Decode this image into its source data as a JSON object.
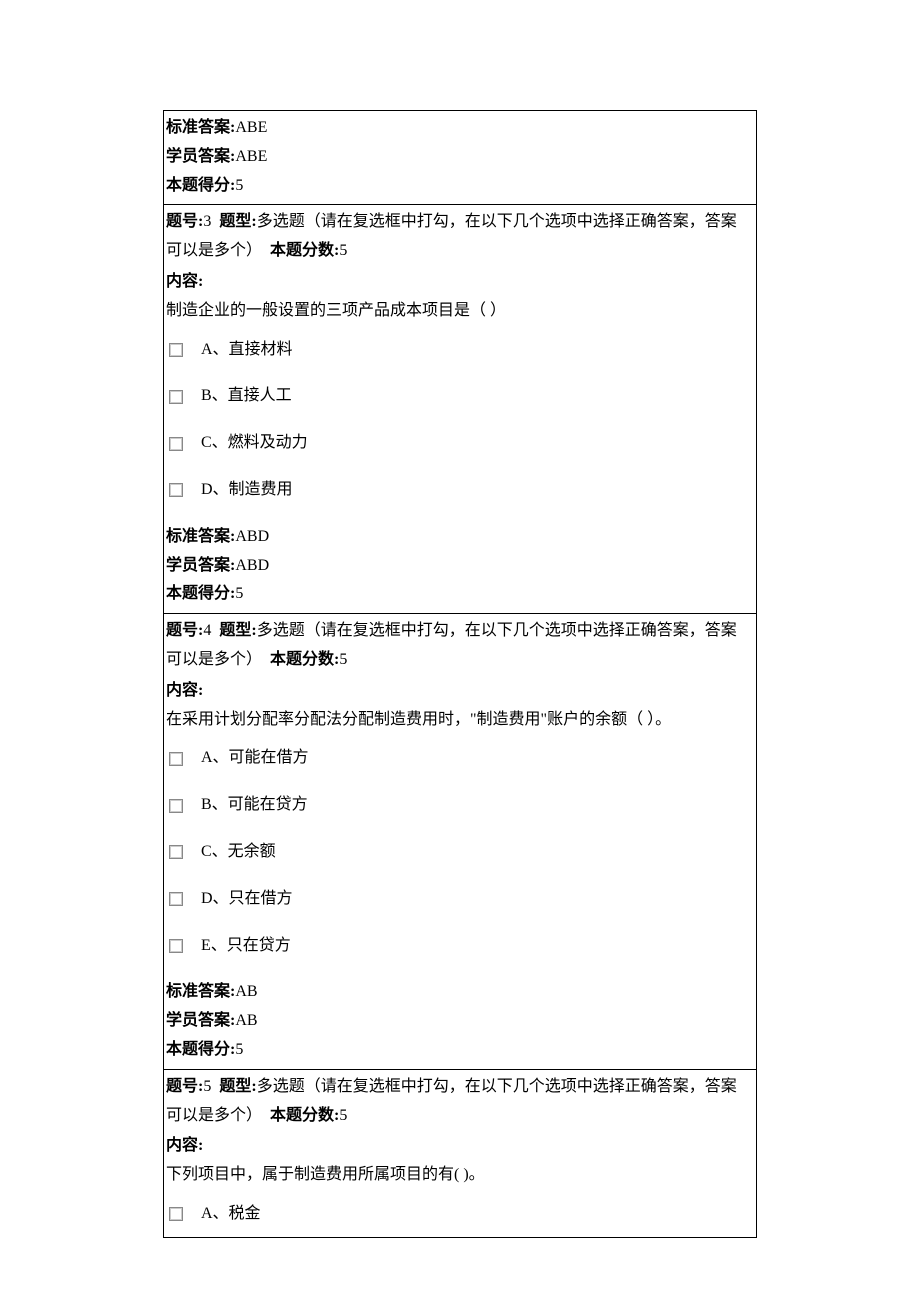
{
  "labels": {
    "standard_answer": "标准答案:",
    "student_answer": "学员答案:",
    "score_obtained": "本题得分:",
    "question_no": "题号:",
    "question_type": "题型:",
    "question_score_label": "本题分数:",
    "content_label": "内容:",
    "type_desc": "多选题（请在复选框中打勾，在以下几个选项中选择正确答案，答案可以是多个）"
  },
  "q2_answers": {
    "standard": "ABE",
    "student": "ABE",
    "score": "5"
  },
  "q3": {
    "no": "3",
    "score": "5",
    "stem": "制造企业的一般设置的三项产品成本项目是（ ）",
    "options": {
      "a": "A、直接材料",
      "b": "B、直接人工",
      "c": "C、燃料及动力",
      "d": "D、制造费用"
    },
    "standard": "ABD",
    "student": "ABD",
    "obtained": "5"
  },
  "q4": {
    "no": "4",
    "score": "5",
    "stem": "在采用计划分配率分配法分配制造费用时，\"制造费用\"账户的余额（ ）。",
    "options": {
      "a": "A、可能在借方",
      "b": "B、可能在贷方",
      "c": "C、无余额",
      "d": "D、只在借方",
      "e": "E、只在贷方"
    },
    "standard": "AB",
    "student": "AB",
    "obtained": "5"
  },
  "q5": {
    "no": "5",
    "score": "5",
    "stem": "下列项目中，属于制造费用所属项目的有( )。",
    "options": {
      "a": "A、税金"
    }
  }
}
